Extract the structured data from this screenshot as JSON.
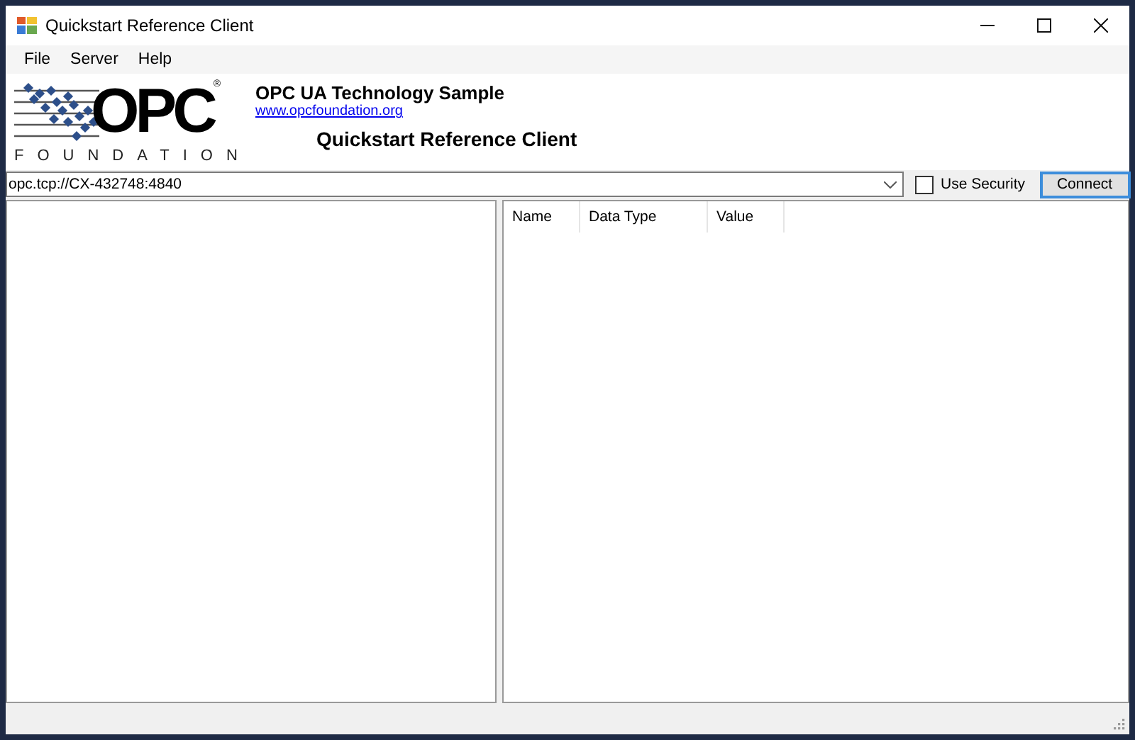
{
  "window": {
    "title": "Quickstart Reference Client"
  },
  "menu": [
    "File",
    "Server",
    "Help"
  ],
  "logo": {
    "mark": "OPC",
    "registered": "®",
    "subtitle": "FOUNDATION"
  },
  "header": {
    "title": "OPC UA Technology Sample",
    "link": "www.opcfoundation.org",
    "subtitle": "Quickstart Reference Client"
  },
  "endpoint": {
    "value": "opc.tcp://CX-432748:4840"
  },
  "use_security": {
    "label": "Use Security",
    "checked": false
  },
  "connect_button": "Connect",
  "table": {
    "columns": [
      "Name",
      "Data Type",
      "Value"
    ]
  }
}
